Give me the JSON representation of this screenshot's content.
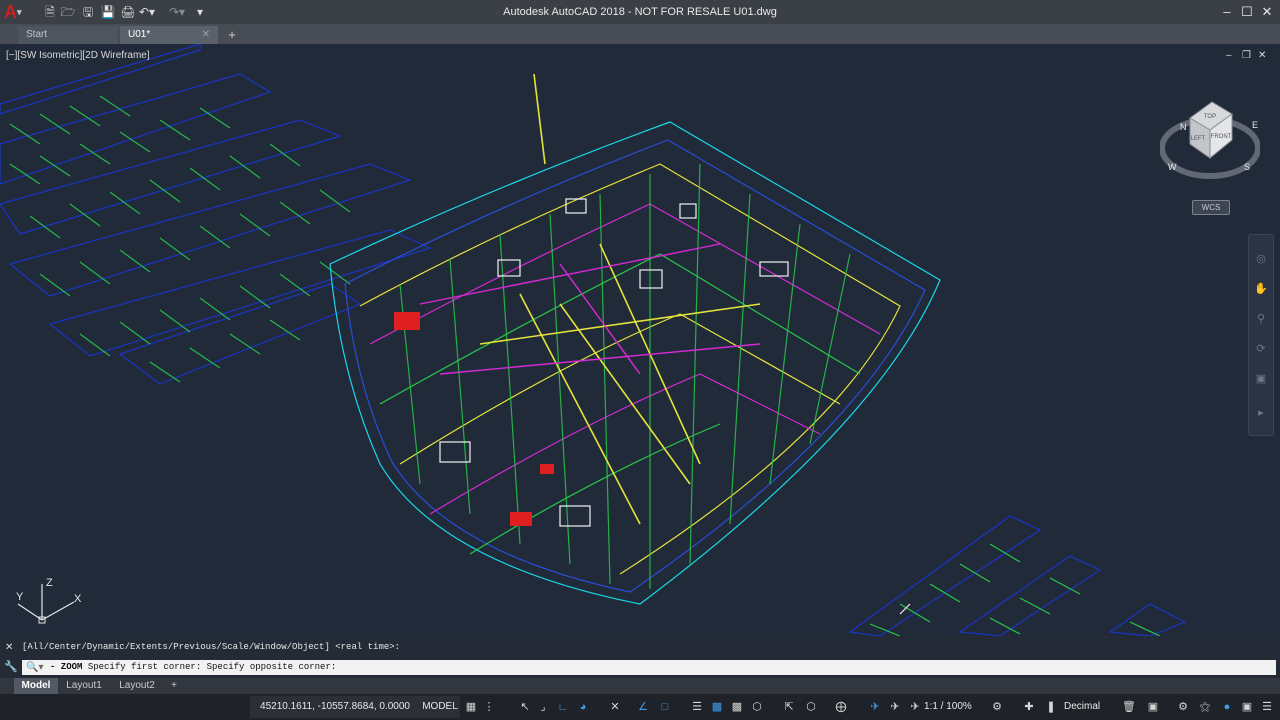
{
  "window": {
    "title": "Autodesk AutoCAD 2018 - NOT FOR RESALE    U01.dwg",
    "app_letter": "A"
  },
  "file_tabs": [
    {
      "label": "Start"
    },
    {
      "label": "U01*"
    }
  ],
  "viewport": {
    "controls_label": "[−][SW Isometric][2D Wireframe]",
    "wcs_label": "WCS",
    "viewcube_faces": {
      "top": "TOP",
      "left": "LEFT",
      "front": "FRONT"
    },
    "compass": {
      "n": "N",
      "w": "W",
      "s": "S",
      "e": "E"
    },
    "ucs_axes": {
      "x": "X",
      "y": "Y",
      "z": "Z"
    }
  },
  "command_line": {
    "history": "[All/Center/Dynamic/Extents/Previous/Scale/Window/Object] <real time>:",
    "prompt_prefix": "- ZOOM",
    "input": "Specify first corner: Specify opposite corner:"
  },
  "layout_tabs": [
    {
      "label": "Model",
      "active": true
    },
    {
      "label": "Layout1"
    },
    {
      "label": "Layout2"
    }
  ],
  "status_bar": {
    "coordinates": "45210.1611, -10557.8684, 0.0000",
    "space": "MODEL",
    "annotation_scale": "1:1 / 100%",
    "units": "Decimal"
  },
  "colors": {
    "background": "#212a39",
    "accent": "#3d9be9",
    "logo_red": "#d11f1f"
  }
}
